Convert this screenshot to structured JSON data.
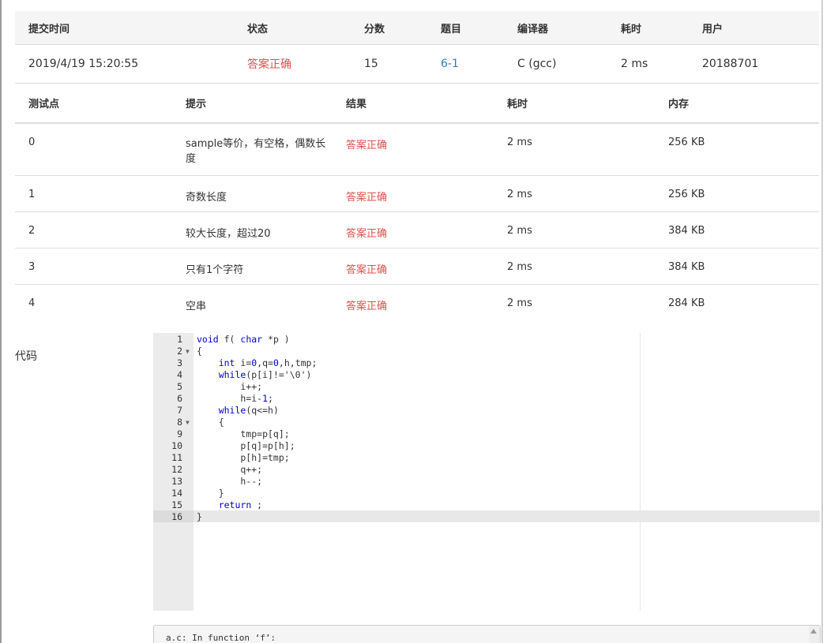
{
  "submission": {
    "headers": {
      "time": "提交时间",
      "status": "状态",
      "score": "分数",
      "problem": "题目",
      "compiler": "编译器",
      "elapsed": "耗时",
      "user": "用户"
    },
    "row": {
      "time": "2019/4/19 15:20:55",
      "status": "答案正确",
      "score": "15",
      "problem": "6-1",
      "compiler": "C (gcc)",
      "elapsed": "2 ms",
      "user": "20188701"
    }
  },
  "cases": {
    "headers": {
      "id": "测试点",
      "hint": "提示",
      "result": "结果",
      "elapsed": "耗时",
      "memory": "内存"
    },
    "rows": [
      {
        "id": "0",
        "hint": "sample等价，有空格，偶数长度",
        "result": "答案正确",
        "elapsed": "2 ms",
        "memory": "256 KB"
      },
      {
        "id": "1",
        "hint": "奇数长度",
        "result": "答案正确",
        "elapsed": "2 ms",
        "memory": "256 KB"
      },
      {
        "id": "2",
        "hint": "较大长度，超过20",
        "result": "答案正确",
        "elapsed": "2 ms",
        "memory": "384 KB"
      },
      {
        "id": "3",
        "hint": "只有1个字符",
        "result": "答案正确",
        "elapsed": "2 ms",
        "memory": "384 KB"
      },
      {
        "id": "4",
        "hint": "空串",
        "result": "答案正确",
        "elapsed": "2 ms",
        "memory": "284 KB"
      }
    ]
  },
  "code": {
    "label": "代码",
    "lines": [
      {
        "n": "1",
        "text": "void f( char *p )"
      },
      {
        "n": "2",
        "text": "{"
      },
      {
        "n": "3",
        "text": "    int i=0,q=0,h,tmp;"
      },
      {
        "n": "4",
        "text": "    while(p[i]!='\\0')"
      },
      {
        "n": "5",
        "text": "        i++;"
      },
      {
        "n": "6",
        "text": "        h=i-1;"
      },
      {
        "n": "7",
        "text": "    while(q<=h)"
      },
      {
        "n": "8",
        "text": "    {"
      },
      {
        "n": "9",
        "text": "        tmp=p[q];"
      },
      {
        "n": "10",
        "text": "        p[q]=p[h];"
      },
      {
        "n": "11",
        "text": "        p[h]=tmp;"
      },
      {
        "n": "12",
        "text": "        q++;"
      },
      {
        "n": "13",
        "text": "        h--;"
      },
      {
        "n": "14",
        "text": "    }"
      },
      {
        "n": "15",
        "text": "    return ;"
      },
      {
        "n": "16",
        "text": "}"
      }
    ],
    "fold_icon": "fold-arrow-icon"
  },
  "compiler_output": {
    "text": "a.c: In function ‘f’:"
  },
  "colors": {
    "accepted": "#d9534f",
    "link": "#337ab7",
    "header_bg": "#f5f5f5",
    "gutter_bg": "#ebebeb"
  }
}
